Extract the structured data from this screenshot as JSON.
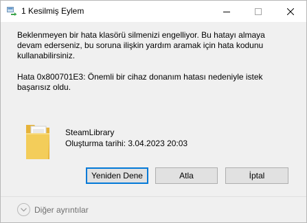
{
  "window": {
    "title": "1 Kesilmiş Eylem",
    "controls": {
      "minimize_icon": "minimize-icon",
      "maximize_icon": "maximize-icon",
      "close_icon": "close-icon"
    }
  },
  "dialog": {
    "message": "Beklenmeyen bir hata klasörü silmenizi engelliyor. Bu hatayı almaya devam ederseniz, bu soruna ilişkin yardım aramak için hata kodunu kullanabilirsiniz.",
    "error": "Hata 0x800701E3: Önemli bir cihaz donanım hatası nedeniyle istek başarısız oldu."
  },
  "file": {
    "icon": "folder-icon",
    "name": "SteamLibrary",
    "created": "Oluşturma tarihi: 3.04.2023 20:03"
  },
  "buttons": {
    "retry": "Yeniden Dene",
    "skip": "Atla",
    "cancel": "İptal"
  },
  "footer": {
    "more_details": "Diğer ayrıntılar",
    "icon": "chevron-down-icon"
  },
  "colors": {
    "accent": "#0078d7",
    "dialog_bg": "#f0f0f0",
    "button_bg": "#e1e1e1",
    "folder_yellow": "#f3cd5a"
  }
}
